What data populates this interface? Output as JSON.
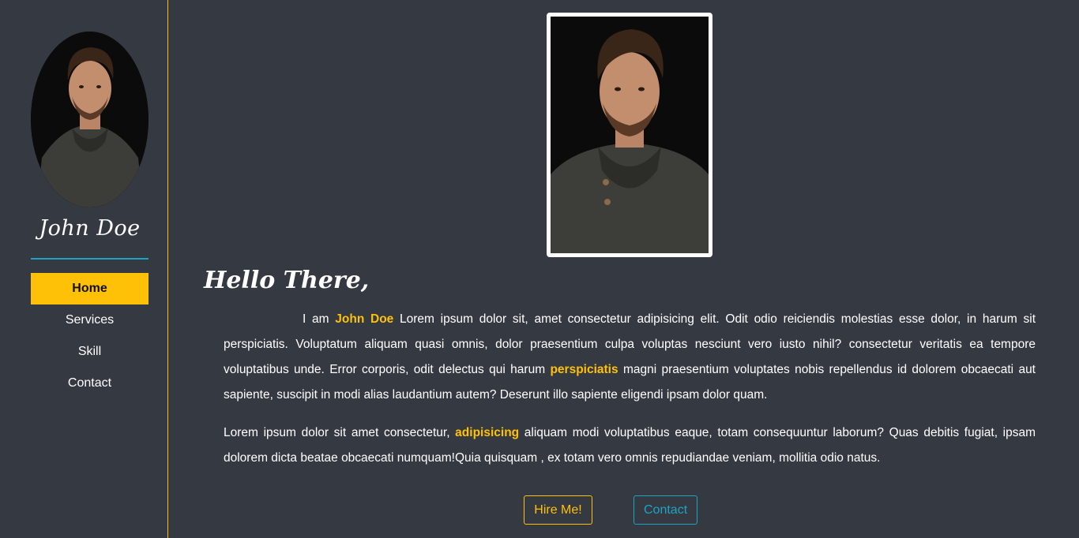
{
  "sidebar": {
    "name": "John Doe",
    "nav": [
      "Home",
      "Services",
      "Skill",
      "Contact"
    ],
    "active": "Home"
  },
  "main": {
    "greeting": "Hello There,",
    "para1": {
      "prefix": "I am ",
      "name": "John Doe",
      "part2": " Lorem ipsum dolor sit, amet consectetur adipisicing elit. Odit odio reiciendis molestias esse dolor, in harum sit perspiciatis. Voluptatum aliquam quasi omnis, dolor praesentium culpa voluptas nesciunt vero iusto nihil? consectetur veritatis ea tempore voluptatibus unde. Error corporis, odit delectus qui harum ",
      "highlight": "perspiciatis",
      "part3": " magni praesentium voluptates nobis repellendus id dolorem obcaecati aut sapiente, suscipit in modi alias laudantium autem? Deserunt illo sapiente eligendi ipsam dolor quam."
    },
    "para2": {
      "part1": "Lorem ipsum dolor sit amet consectetur, ",
      "highlight": "adipisicing",
      "part2": " aliquam modi voluptatibus eaque, totam consequuntur laborum? Quas debitis fugiat, ipsam dolorem dicta beatae obcaecati numquam!Quia quisquam , ex totam vero omnis repudiandae veniam, mollitia odio natus."
    },
    "buttons": {
      "hire": "Hire Me!",
      "contact": "Contact"
    }
  },
  "colors": {
    "background": "#353a42",
    "accent": "#ffc107",
    "secondary": "#1fa3c4"
  }
}
